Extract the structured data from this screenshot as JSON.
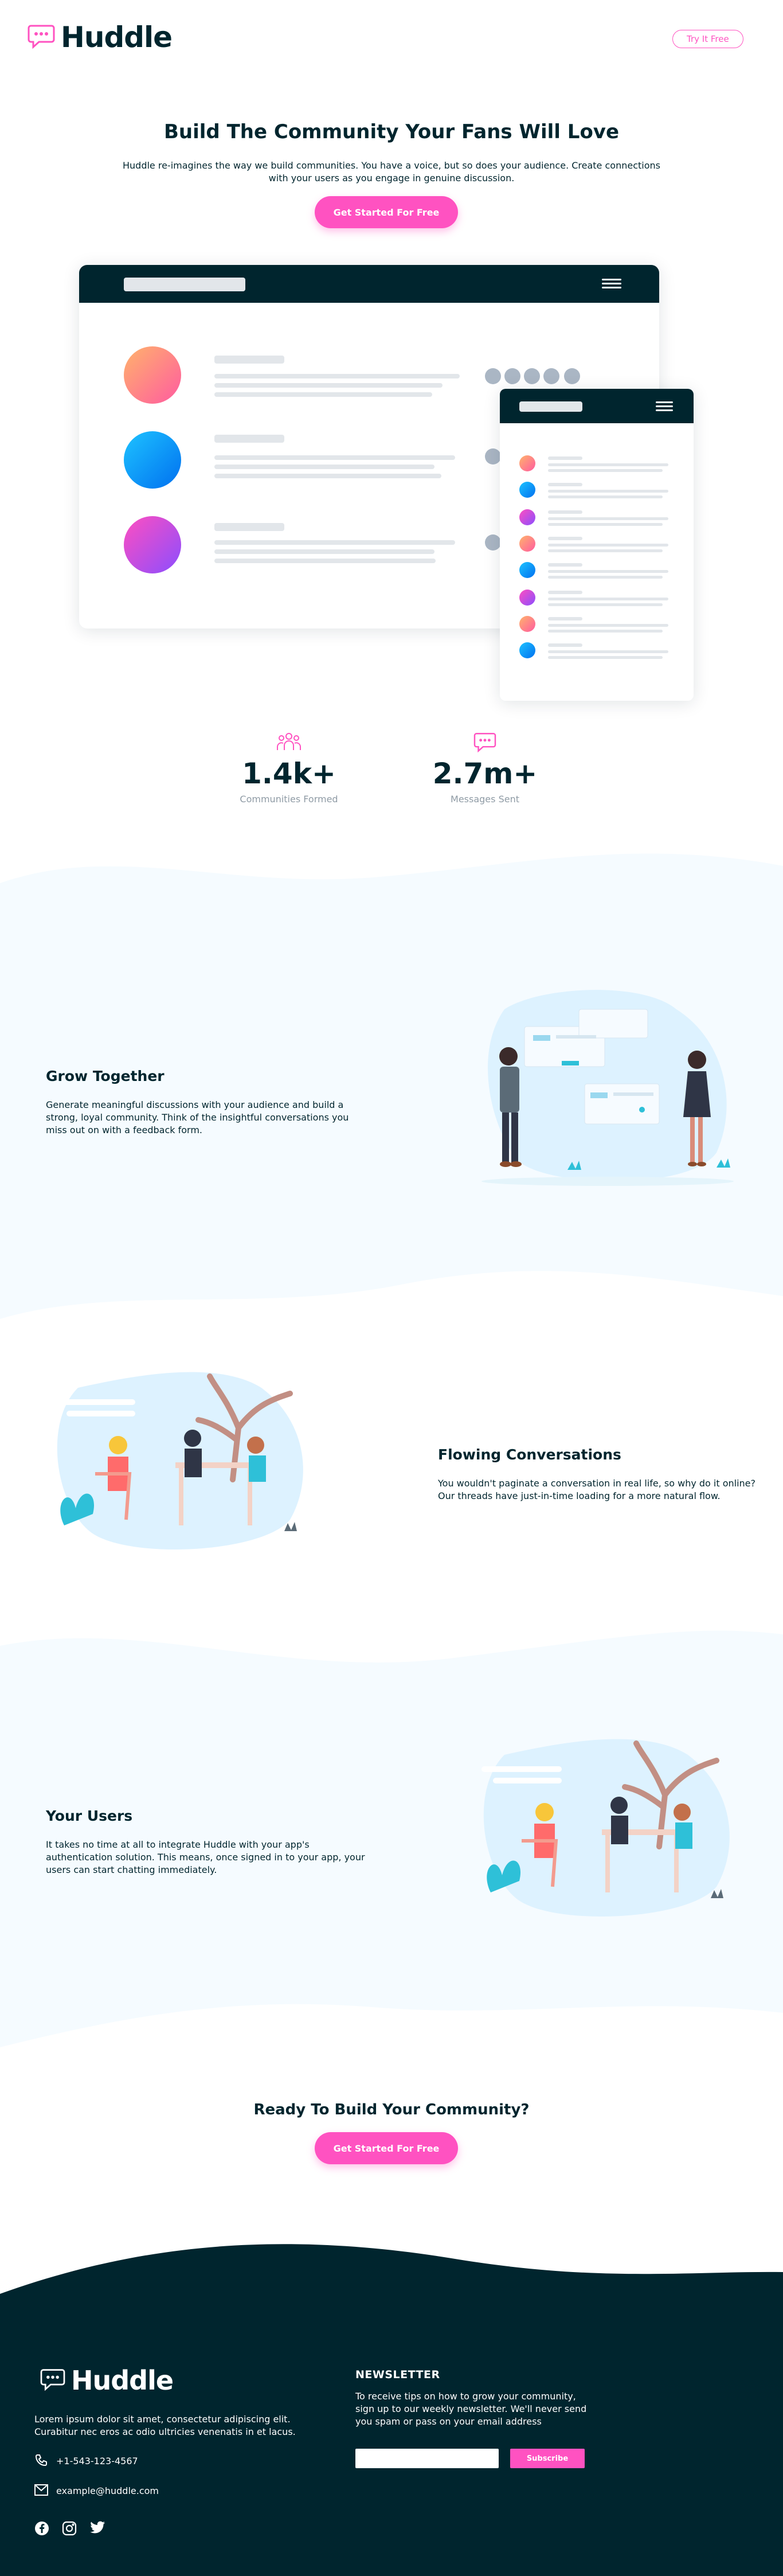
{
  "header": {
    "logo_text": "Huddle",
    "try_button": "Try It Free"
  },
  "hero": {
    "title": "Build The Community Your Fans Will Love",
    "subtitle_line1": "Huddle re-imagines the way we build communities. You have a voice, but so does your audience. Create connections",
    "subtitle_line2": "with your users as you engage in genuine discussion.",
    "cta": "Get Started For Free"
  },
  "stats": [
    {
      "value": "1.4k+",
      "label": "Communities Formed",
      "icon": "communities-icon"
    },
    {
      "value": "2.7m+",
      "label": "Messages Sent",
      "icon": "messages-icon"
    }
  ],
  "features": [
    {
      "title": "Grow Together",
      "lines": [
        "Generate meaningful discussions with your audience and build a",
        "strong, loyal community. Think of the insightful conversations you",
        "miss out on with a feedback form."
      ]
    },
    {
      "title": "Flowing Conversations",
      "lines": [
        "You wouldn't paginate a conversation in real life, so why do it online?",
        "Our threads have just-in-time loading for a more natural flow."
      ]
    },
    {
      "title": "Your Users",
      "lines": [
        "It takes no time at all to integrate Huddle with your app's",
        "authentication solution. This means, once signed in to your app, your",
        "users can start chatting immediately."
      ]
    }
  ],
  "cta_section": {
    "title": "Ready To Build Your Community?",
    "button": "Get Started For Free"
  },
  "footer": {
    "logo_text": "Huddle",
    "about_line1": "Lorem ipsum dolor sit amet, consectetur adipiscing elit.",
    "about_line2": "Curabitur nec eros ac odio ultricies venenatis in et lacus.",
    "phone": "+1-543-123-4567",
    "email": "example@huddle.com",
    "newsletter_title": "NEWSLETTER",
    "newsletter_line1": "To receive tips on how to grow your community,",
    "newsletter_line2": "sign up to our weekly newsletter. We'll never send",
    "newsletter_line3": "you spam or pass on your email address",
    "subscribe": "Subscribe",
    "social": [
      "facebook-icon",
      "instagram-icon",
      "twitter-icon"
    ]
  },
  "colors": {
    "primary": "#00252e",
    "accent": "#ff52c1",
    "section_bg": "#f5fbff"
  }
}
